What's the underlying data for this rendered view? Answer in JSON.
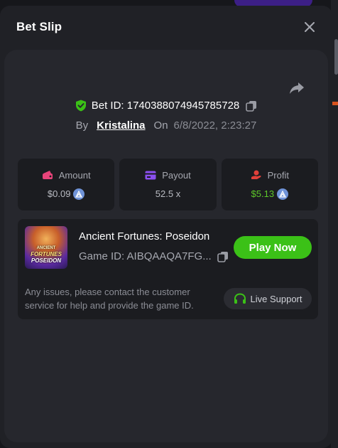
{
  "modal": {
    "title": "Bet Slip",
    "close_icon": "close-icon",
    "share_icon": "share-icon"
  },
  "bet": {
    "id_label": "Bet ID: 1740388074945785728",
    "by_label": "By",
    "user": "Kristalina",
    "on_label": "On",
    "date": "6/8/2022, 2:23:27"
  },
  "stats": {
    "amount": {
      "label": "Amount",
      "value": "$0.09",
      "icon": "wallet-icon",
      "icon_color": "#e8447a"
    },
    "payout": {
      "label": "Payout",
      "value": "52.5 x",
      "icon": "card-icon",
      "icon_color": "#8b4ff0"
    },
    "profit": {
      "label": "Profit",
      "value": "$5.13",
      "icon": "hand-coin-icon",
      "icon_color": "#e0403a",
      "value_color": "#5ec82a"
    }
  },
  "game": {
    "thumb_line1": "ANCIENT",
    "thumb_line2": "FORTUNES",
    "thumb_line3": "POSEIDON",
    "name": "Ancient Fortunes: Poseidon",
    "id_label": "Game ID: AIBQAAQA7FG...",
    "play_label": "Play Now",
    "help_text": "Any issues, please contact the customer service for help and provide the game ID.",
    "support_label": "Live Support"
  },
  "colors": {
    "accent_green": "#3bc117",
    "verified_green": "#3bc117",
    "coin_blue": "#6f93d8"
  }
}
